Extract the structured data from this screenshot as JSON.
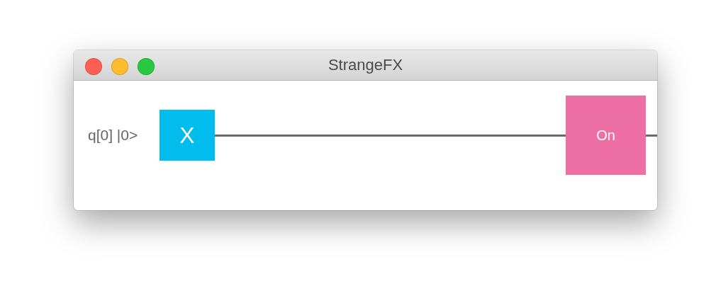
{
  "window": {
    "title": "StrangeFX"
  },
  "circuit": {
    "qubit_label": "q[0] |0>",
    "gates": [
      {
        "kind": "gate",
        "label": "X",
        "color": "#00bdee"
      },
      {
        "kind": "measurement",
        "label": "On",
        "color": "#ee6fa4"
      }
    ]
  }
}
